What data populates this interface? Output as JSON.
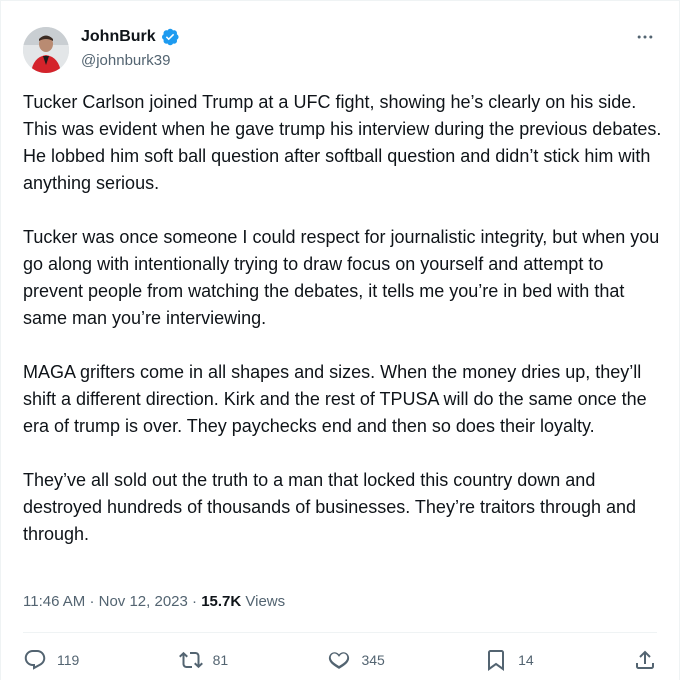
{
  "author": {
    "display_name": "JohnBurk",
    "handle": "@johnburk39"
  },
  "tweet": {
    "text": "Tucker Carlson joined Trump at a UFC fight, showing he’s clearly on his side. This was evident when he gave trump his interview during the previous debates. He lobbed him soft ball question after softball question and didn’t stick him with anything serious.\n\nTucker was once someone I could respect for journalistic integrity, but when you go along with intentionally trying to draw focus on yourself and attempt to prevent people from watching the debates, it tells me you’re in bed with that same man you’re interviewing.\n\nMAGA grifters come in all shapes and sizes. When the money dries up, they’ll shift a different direction. Kirk and the rest of TPUSA will do the same once the era of trump is over. They paychecks end and then so does their loyalty.\n\nThey’ve all sold out the truth to a man that locked this country down and destroyed hundreds of thousands of businesses. They’re traitors through and through.",
    "time": "11:46 AM",
    "date": "Nov 12, 2023",
    "views_count": "15.7K",
    "views_label": "Views"
  },
  "actions": {
    "replies": "119",
    "reposts": "81",
    "likes": "345",
    "bookmarks": "14"
  },
  "icons": {
    "verified": "verified-badge-icon",
    "more": "more-icon",
    "reply": "reply-icon",
    "repost": "repost-icon",
    "like": "heart-icon",
    "bookmark": "bookmark-icon",
    "share": "share-icon"
  },
  "colors": {
    "text": "#0f1419",
    "secondary": "#536471",
    "verified": "#1d9bf0",
    "border": "#eff3f4"
  }
}
